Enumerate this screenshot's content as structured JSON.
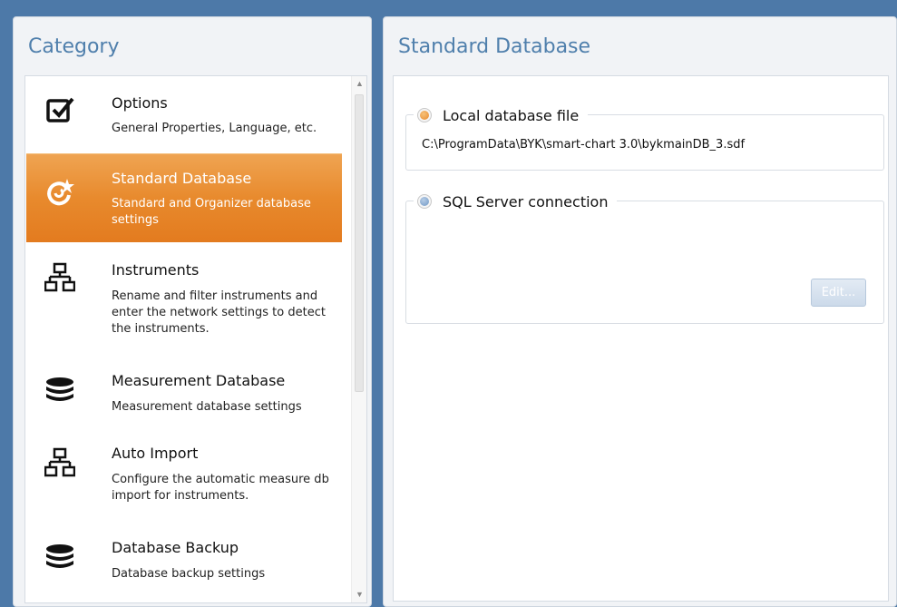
{
  "category_panel": {
    "title": "Category",
    "items": [
      {
        "title": "Options",
        "description": "General Properties, Language, etc.",
        "icon": "checkbox-icon",
        "selected": false
      },
      {
        "title": "Standard Database",
        "description": "Standard and Organizer database settings",
        "icon": "refresh-star-icon",
        "selected": true
      },
      {
        "title": "Instruments",
        "description": "Rename and filter instruments and enter the network settings to detect the instruments.",
        "icon": "network-icon",
        "selected": false
      },
      {
        "title": "Measurement Database",
        "description": "Measurement database settings",
        "icon": "database-icon",
        "selected": false
      },
      {
        "title": "Auto Import",
        "description": "Configure the automatic measure db import for instruments.",
        "icon": "network-icon",
        "selected": false
      },
      {
        "title": "Database Backup",
        "description": "Database backup settings",
        "icon": "database-icon",
        "selected": false
      }
    ]
  },
  "detail_panel": {
    "title": "Standard Database",
    "local_db": {
      "label": "Local database file",
      "path": "C:\\ProgramData\\BYK\\smart-chart 3.0\\bykmainDB_3.sdf",
      "checked": true
    },
    "sql_server": {
      "label": "SQL Server connection",
      "checked": false,
      "edit_label": "Edit..."
    }
  },
  "colors": {
    "accent": "#4f7fac",
    "selected_orange": "#e88a2d",
    "background": "#4d79a8"
  }
}
